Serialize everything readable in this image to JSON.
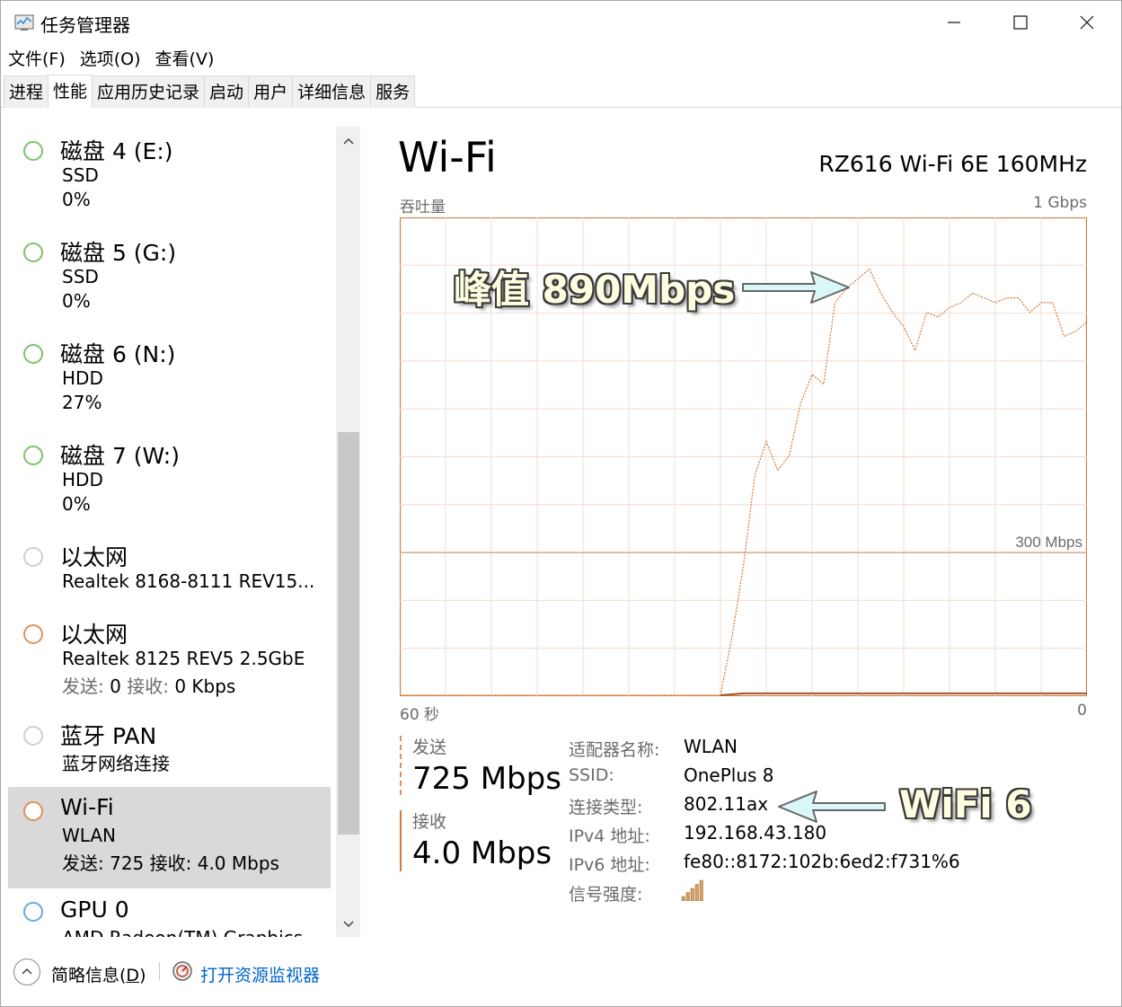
{
  "window": {
    "title": "任务管理器",
    "icon": "task-manager-icon"
  },
  "menu": [
    "文件(F)",
    "选项(O)",
    "查看(V)"
  ],
  "tabs": [
    "进程",
    "性能",
    "应用历史记录",
    "启动",
    "用户",
    "详细信息",
    "服务"
  ],
  "active_tab": "性能",
  "sidebar": [
    {
      "name": "磁盘 4 (E:)",
      "line1": "SSD",
      "line2": "0%",
      "status_color": "#7cc36b"
    },
    {
      "name": "磁盘 5 (G:)",
      "line1": "SSD",
      "line2": "0%",
      "status_color": "#7cc36b"
    },
    {
      "name": "磁盘 6 (N:)",
      "line1": "HDD",
      "line2": "27%",
      "status_color": "#7cc36b"
    },
    {
      "name": "磁盘 7 (W:)",
      "line1": "HDD",
      "line2": "0%",
      "status_color": "#7cc36b"
    },
    {
      "name": "以太网",
      "line1": "Realtek 8168-8111 REV15...",
      "status_color": "#cfcfcf"
    },
    {
      "name": "以太网",
      "line1": "Realtek 8125 REV5 2.5GbE",
      "line2_label_send": "发送:",
      "line2_send": "0",
      "line2_label_recv": "接收:",
      "line2_recv": "0 Kbps",
      "status_color": "#e0915a"
    },
    {
      "name": "蓝牙 PAN",
      "line1": "蓝牙网络连接",
      "status_color": "#cfcfcf"
    },
    {
      "name": "Wi-Fi",
      "line1": "WLAN",
      "line2": "发送: 725 接收: 4.0 Mbps",
      "status_color": "#e0915a",
      "selected": true
    },
    {
      "name": "GPU 0",
      "line1": "AMD Radeon(TM) Graphics",
      "status_color": "#6aa9d8"
    }
  ],
  "main": {
    "title": "Wi-Fi",
    "adapter": "RZ616 Wi-Fi 6E 160MHz",
    "throughput_label": "吞吐量",
    "max_label": "1 Gbps",
    "time_left": "60 秒",
    "time_right": "0",
    "send_label": "发送",
    "send_value": "725 Mbps",
    "recv_label": "接收",
    "recv_value": "4.0 Mbps",
    "info": [
      {
        "k": "适配器名称:",
        "v": "WLAN"
      },
      {
        "k": "SSID:",
        "v": "OnePlus 8"
      },
      {
        "k": "连接类型:",
        "v": "802.11ax"
      },
      {
        "k": "IPv4 地址:",
        "v": "192.168.43.180"
      },
      {
        "k": "IPv6 地址:",
        "v": "fe80::8172:102b:6ed2:f731%6"
      },
      {
        "k": "信号强度:",
        "v": ""
      }
    ],
    "signal_bars": 5
  },
  "annotations": {
    "peak": "峰值 890Mbps",
    "wifi6": "WiFi 6"
  },
  "chart_data": {
    "type": "line",
    "xlabel": "",
    "ylabel": "",
    "title": "",
    "x_range_label": [
      "60 秒",
      "0"
    ],
    "ylim_mbps": [
      0,
      1000
    ],
    "scale_line": {
      "label": "300 Mbps",
      "value": 300
    },
    "series": [
      {
        "x_seconds_ago": [
          60,
          32,
          31,
          30,
          29,
          28,
          27,
          26,
          25,
          24,
          23,
          22,
          21,
          20,
          19,
          18,
          17,
          16,
          15,
          14,
          13,
          12,
          11,
          10,
          9,
          8,
          7,
          6,
          5,
          4,
          3,
          2,
          1,
          0
        ],
        "values": [
          0,
          0,
          120,
          270,
          460,
          530,
          470,
          500,
          610,
          670,
          650,
          820,
          850,
          870,
          890,
          840,
          800,
          770,
          720,
          800,
          790,
          810,
          820,
          840,
          830,
          820,
          830,
          830,
          800,
          820,
          820,
          750,
          760,
          780
        ]
      },
      {
        "x_seconds_ago": [
          60,
          30,
          20,
          10,
          0
        ],
        "values": [
          0,
          4,
          4,
          4,
          4
        ]
      }
    ]
  },
  "footer": {
    "fewer_details": "简略信息(D)",
    "open_resource_monitor": "打开资源监视器"
  }
}
